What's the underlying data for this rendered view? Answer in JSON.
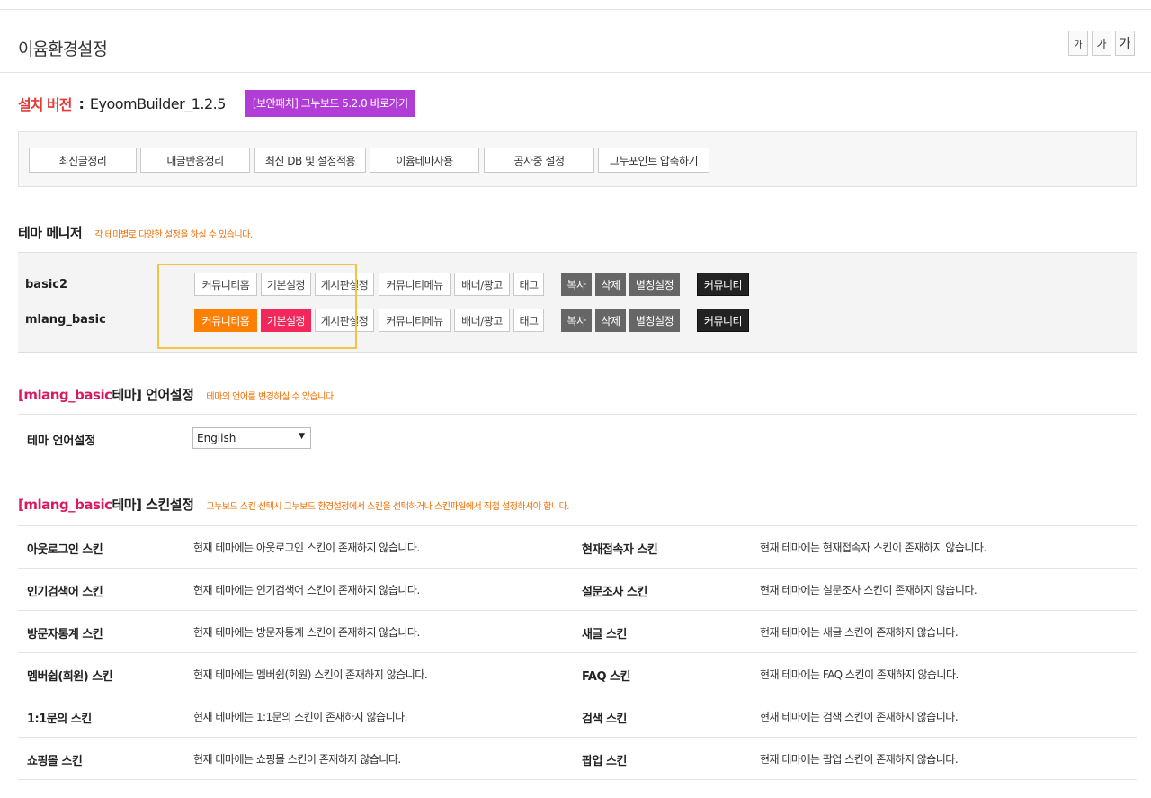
{
  "page": {
    "title": "이윰환경설정"
  },
  "font_size_buttons": [
    "가",
    "가",
    "가"
  ],
  "version": {
    "label": "설치 버전",
    "colon": ":",
    "value": "EyoomBuilder_1.2.5",
    "patch_button": "[보안패치] 그누보드 5.2.0 바로가기"
  },
  "tools": [
    "최신글정리",
    "내글반응정리",
    "최신 DB 및 설정적용",
    "이윰테마사용",
    "공사중 설정",
    "그누포인트 압축하기"
  ],
  "theme_manager": {
    "title": "테마 메니저",
    "desc": "각 테마별로 다양한 설정을 하실 수 있습니다.",
    "themes": [
      {
        "name": "basic2",
        "buttons": [
          "커뮤니티홈",
          "기본설정",
          "게시판설정",
          "커뮤니티메뉴",
          "배너/광고",
          "태그"
        ],
        "actions": [
          "복사",
          "삭제",
          "별칭설정"
        ],
        "community": "커뮤니티"
      },
      {
        "name": "mlang_basic",
        "buttons": [
          "커뮤니티홈",
          "기본설정",
          "게시판설정",
          "커뮤니티메뉴",
          "배너/광고",
          "태그"
        ],
        "actions": [
          "복사",
          "삭제",
          "별칭설정"
        ],
        "community": "커뮤니티"
      }
    ]
  },
  "language": {
    "title_accent": "[mlang_basic",
    "title_rest": " 테마] 언어설정",
    "desc": "테마의 언어를 변경하실 수 있습니다.",
    "label": "테마 언어설정",
    "selected": "English"
  },
  "skin": {
    "title_accent": "[mlang_basic",
    "title_rest": " 테마] 스킨설정",
    "desc": "그누보드 스킨 선택시 그누보드 환경설정에서 스킨을 선택하거나 스킨파일에서 직접 설정하셔야 합니다.",
    "rows": [
      {
        "left_label": "아웃로그인 스킨",
        "left_text": "현재 테마에는 아웃로그인 스킨이 존재하지 않습니다.",
        "right_label": "현재접속자 스킨",
        "right_text": "현재 테마에는 현재접속자 스킨이 존재하지 않습니다."
      },
      {
        "left_label": "인기검색어 스킨",
        "left_text": "현재 테마에는 인기검색어 스킨이 존재하지 않습니다.",
        "right_label": "설문조사 스킨",
        "right_text": "현재 테마에는 설문조사 스킨이 존재하지 않습니다."
      },
      {
        "left_label": "방문자통계 스킨",
        "left_text": "현재 테마에는 방문자통계 스킨이 존재하지 않습니다.",
        "right_label": "새글 스킨",
        "right_text": "현재 테마에는 새글 스킨이 존재하지 않습니다."
      },
      {
        "left_label": "멤버쉽(회원) 스킨",
        "left_text": "현재 테마에는 멤버쉽(회원) 스킨이 존재하지 않습니다.",
        "right_label": "FAQ 스킨",
        "right_text": "현재 테마에는 FAQ 스킨이 존재하지 않습니다."
      },
      {
        "left_label": "1:1문의 스킨",
        "left_text": "현재 테마에는 1:1문의 스킨이 존재하지 않습니다.",
        "right_label": "검색 스킨",
        "right_text": "현재 테마에는 검색 스킨이 존재하지 않습니다."
      },
      {
        "left_label": "쇼핑몰 스킨",
        "left_text": "현재 테마에는 쇼핑몰 스킨이 존재하지 않습니다.",
        "right_label": "팝업 스킨",
        "right_text": "현재 테마에는 팝업 스킨이 존재하지 않습니다."
      }
    ]
  }
}
